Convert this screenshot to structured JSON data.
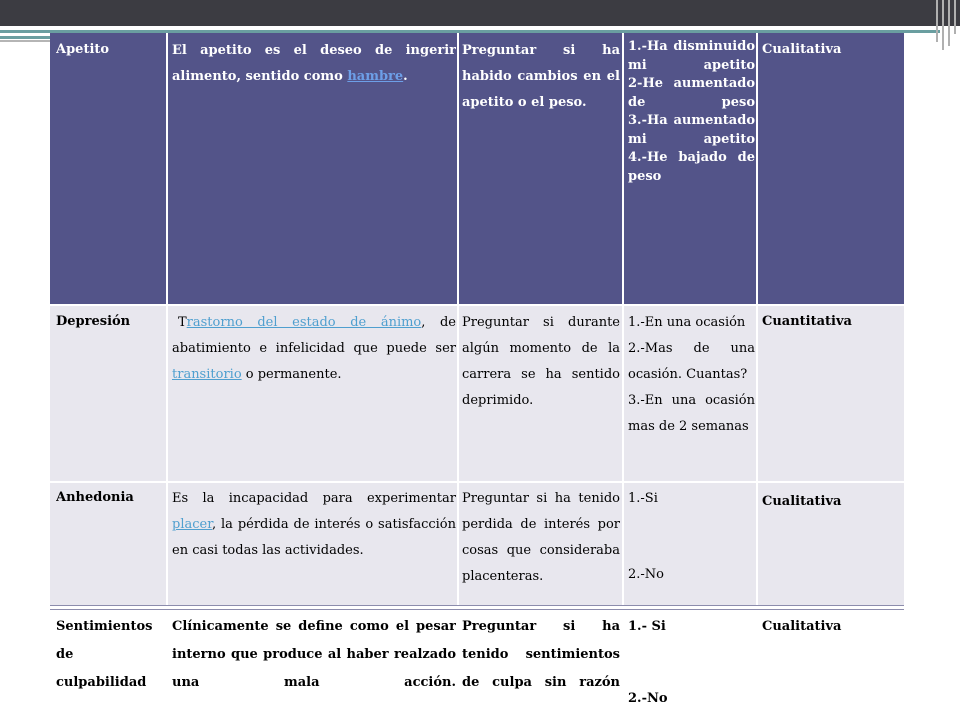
{
  "table": {
    "rows": [
      {
        "term": "Apetito",
        "definition": {
          "before": "El apetito es el deseo de ingerir alimento, sentido como ",
          "link": "hambre",
          "after": "."
        },
        "question": "Preguntar si ha habido cambios en el apetito o el peso.",
        "options": [
          "1.-Ha disminuido mi apetito",
          "2-He aumentado de peso",
          "3.-Ha aumentado mi apetito",
          "4.-He bajado de peso"
        ],
        "type": "Cualitativa"
      },
      {
        "term": "Depresión",
        "definition": {
          "prefix": "T",
          "link1": "rastorno del estado de ánimo",
          "middle": ", de abatimiento e infelicidad que puede ser ",
          "link2": "transitorio",
          "after": " o permanente."
        },
        "question": "Preguntar si durante algún momento de la carrera se ha sentido deprimido.",
        "options": [
          "1.-En una ocasión",
          "2.-Mas de una ocasión. Cuantas?",
          "3.-En una ocasión mas de 2 semanas"
        ],
        "type": "Cuantitativa"
      },
      {
        "term": "Anhedonia",
        "definition": {
          "before": "Es la incapacidad para experimentar ",
          "link": "placer",
          "after": ", la pérdida de interés o satisfacción en casi todas las actividades."
        },
        "question": "Preguntar si ha tenido perdida de interés por cosas que consideraba placenteras.",
        "options": [
          "1.-Si",
          "2.-No"
        ],
        "type": "Cualitativa"
      },
      {
        "term": "Sentimientos de culpabilidad",
        "definition": "Clínicamente se define como el pesar interno que produce al haber realzado una mala acción.",
        "question": "Preguntar si ha tenido sentimientos de culpa sin razón",
        "options": [
          "1.- Si",
          "2.-No"
        ],
        "type": "Cualitativa"
      }
    ]
  }
}
